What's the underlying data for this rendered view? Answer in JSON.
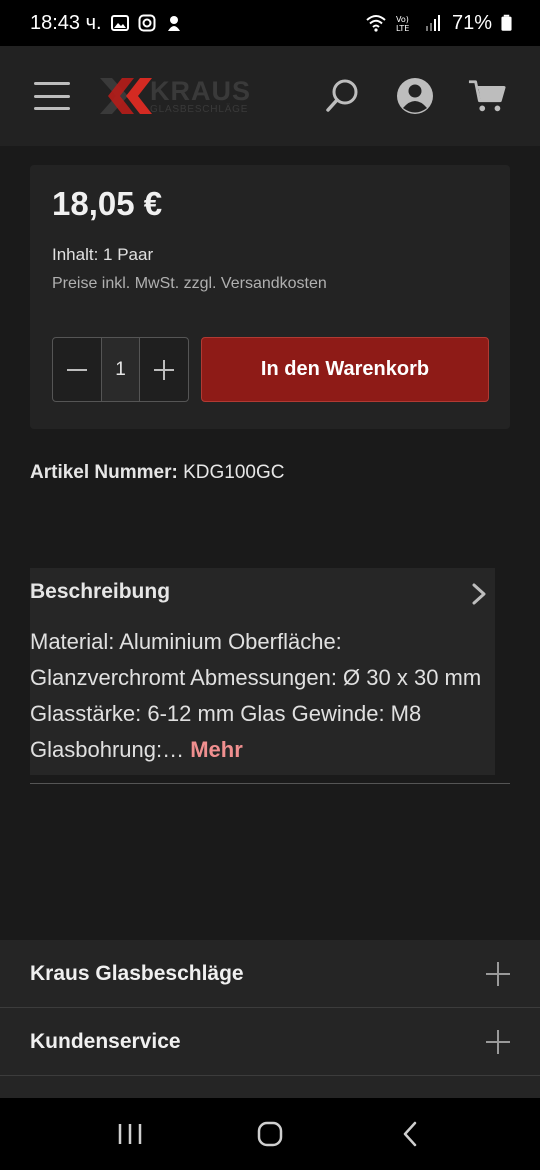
{
  "status_bar": {
    "time": "18:43 ч.",
    "battery": "71%"
  },
  "header": {
    "logo_main": "KRAUS",
    "logo_sub": "GLASBESCHLÄGE",
    "icons": [
      "menu-icon",
      "search-icon",
      "account-icon",
      "cart-icon"
    ]
  },
  "buybox": {
    "price": "18,05 €",
    "content": "Inhalt: 1 Paar",
    "tax_note": "Preise inkl. MwSt. zzgl. Versandkosten",
    "quantity": "1",
    "add_to_cart": "In den Warenkorb"
  },
  "article": {
    "label": "Artikel Nummer:",
    "value": "KDG100GC"
  },
  "description": {
    "title": "Beschreibung",
    "text": "Material: Aluminium Oberfläche: Glanzverchromt Abmessungen: Ø 30 x 30 mm Glasstärke: 6-12 mm Glas Gewinde: M8 Glasbohrung:…",
    "more": "Mehr"
  },
  "footer": {
    "items": [
      {
        "label": "Kraus Glasbeschläge"
      },
      {
        "label": "Kundenservice"
      }
    ]
  },
  "colors": {
    "accent": "#8e1b17",
    "more_link": "#f08f8f",
    "background": "#1a1a1a"
  }
}
